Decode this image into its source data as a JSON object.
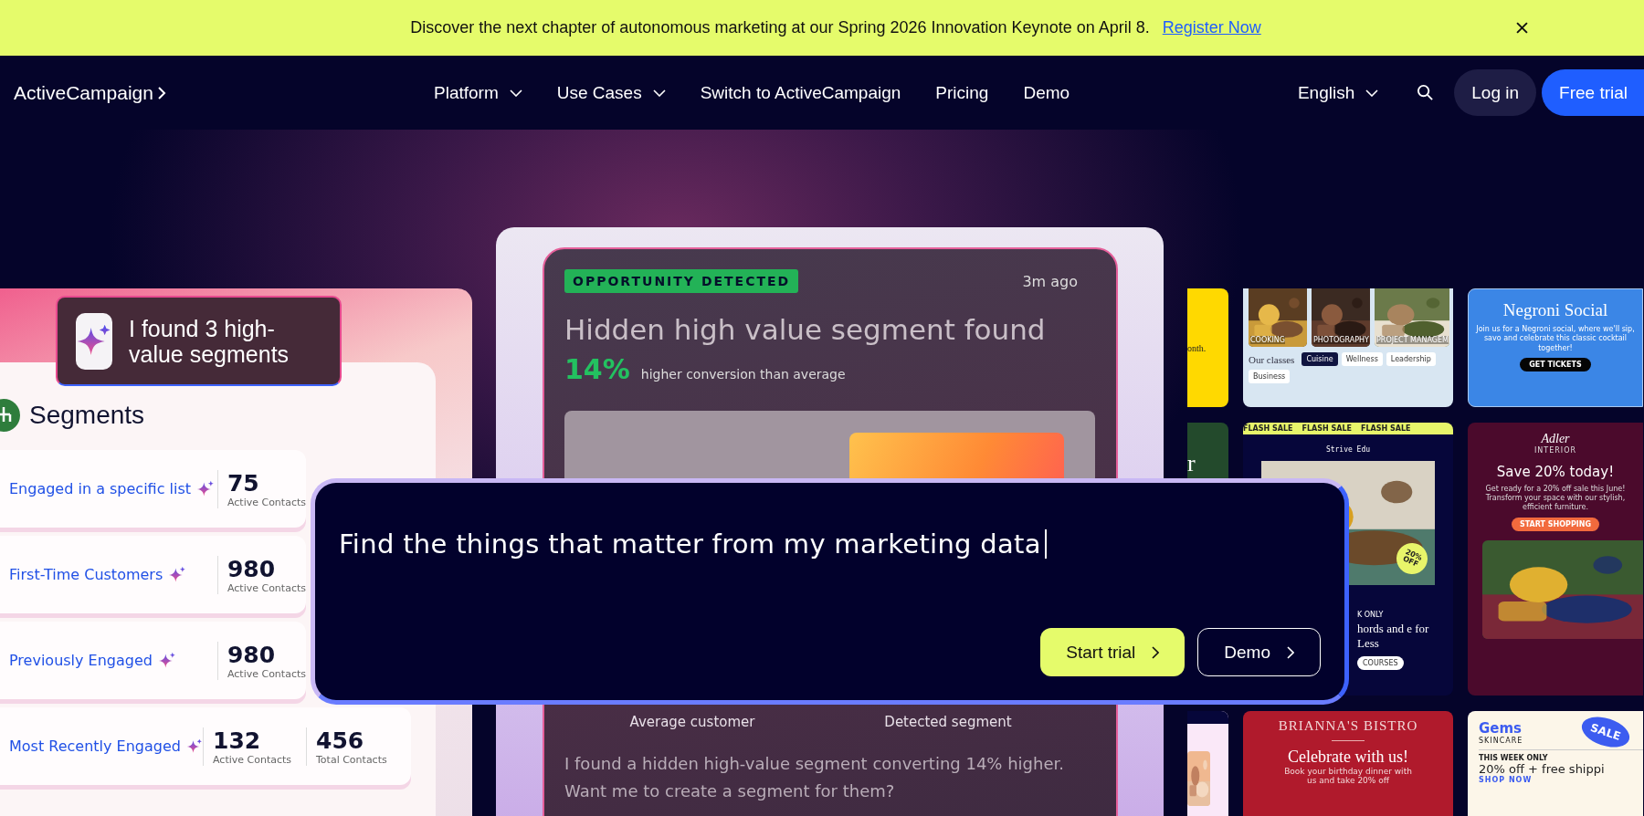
{
  "banner": {
    "text": "Discover the next chapter of autonomous marketing at our Spring 2026 Innovation Keynote on April 8.",
    "link": "Register Now"
  },
  "nav": {
    "logo": "ActiveCampaign",
    "items": [
      {
        "label": "Platform",
        "dropdown": true
      },
      {
        "label": "Use Cases",
        "dropdown": true
      },
      {
        "label": "Switch to ActiveCampaign",
        "dropdown": false
      },
      {
        "label": "Pricing",
        "dropdown": false
      },
      {
        "label": "Demo",
        "dropdown": false
      }
    ],
    "language": "English",
    "login": "Log in",
    "trial": "Free trial"
  },
  "segments_panel": {
    "bubble": "I found 3 high-value segments",
    "title": "Segments",
    "rows": [
      {
        "name": "Engaged in a specific list",
        "stats": [
          {
            "value": "75",
            "label": "Active Contacts"
          }
        ]
      },
      {
        "name": "First-Time Customers",
        "stats": [
          {
            "value": "980",
            "label": "Active Contacts"
          }
        ]
      },
      {
        "name": "Previously Engaged",
        "stats": [
          {
            "value": "980",
            "label": "Active Contacts"
          }
        ]
      },
      {
        "name": "Most Recently Engaged",
        "stats": [
          {
            "value": "132",
            "label": "Active Contacts"
          },
          {
            "value": "456",
            "label": "Total Contacts"
          }
        ]
      }
    ]
  },
  "insight_card": {
    "badge": "OPPORTUNITY DETECTED",
    "time": "3m ago",
    "title": "Hidden high value segment found",
    "stat": "14%",
    "stat_caption": "higher conversion than average",
    "bar_labels": [
      "Average customer",
      "Detected segment"
    ],
    "message": "I found a hidden high-value segment converting 14% higher. Want me to create a segment for them?"
  },
  "prompt": {
    "text": "Find the things that matter from my marketing data",
    "buttons": [
      {
        "label": "Start trial",
        "kind": "primary"
      },
      {
        "label": "Demo",
        "kind": "secondary"
      }
    ]
  },
  "templates": [
    {
      "kind": "yellow",
      "texts": [
        "onth."
      ]
    },
    {
      "kind": "classes",
      "photo_labels": [
        "COOKING",
        "PHOTOGRAPHY",
        "PROJECT MANAGEM"
      ],
      "heading": "Our classes",
      "chips": [
        {
          "label": "Cuisine",
          "selected": true
        },
        {
          "label": "Wellness",
          "selected": false
        },
        {
          "label": "Leadership",
          "selected": false
        },
        {
          "label": "Business",
          "selected": false
        }
      ]
    },
    {
      "kind": "event",
      "title": "Negroni Social",
      "body": "Join us for a Negroni social, where we'll sip, savo and celebrate this classic cocktail together!",
      "cta": "GET TICKETS"
    },
    {
      "kind": "green",
      "texts": [
        "r"
      ]
    },
    {
      "kind": "flash",
      "strip": [
        "FLASH SALE",
        "FLASH SALE",
        "FLASH SALE"
      ],
      "brand": "Strive Edu",
      "badge": "20% OFF",
      "eyebrow": "K ONLY",
      "title": "hords and e for Less",
      "cta": "COURSES"
    },
    {
      "kind": "promo",
      "brand": "Adler",
      "sub": "INTERIOR",
      "title": "Save 20% today!",
      "body": "Get ready for a 20% off sale this June! Transform your space with our stylish, efficient furniture.",
      "cta": "START SHOPPING"
    },
    {
      "kind": "flash_small"
    },
    {
      "kind": "bistro",
      "brand": "BRIANNA'S BISTRO",
      "title": "Celebrate with us!",
      "body": "Book your birthday dinner with us and take 20% off"
    },
    {
      "kind": "sale",
      "brand": "Gems",
      "sub": "SKINCARE",
      "badge": "SALE",
      "eyebrow": "THIS WEEK ONLY",
      "title": "20% off + free shippi",
      "cta": "SHOP NOW"
    }
  ]
}
